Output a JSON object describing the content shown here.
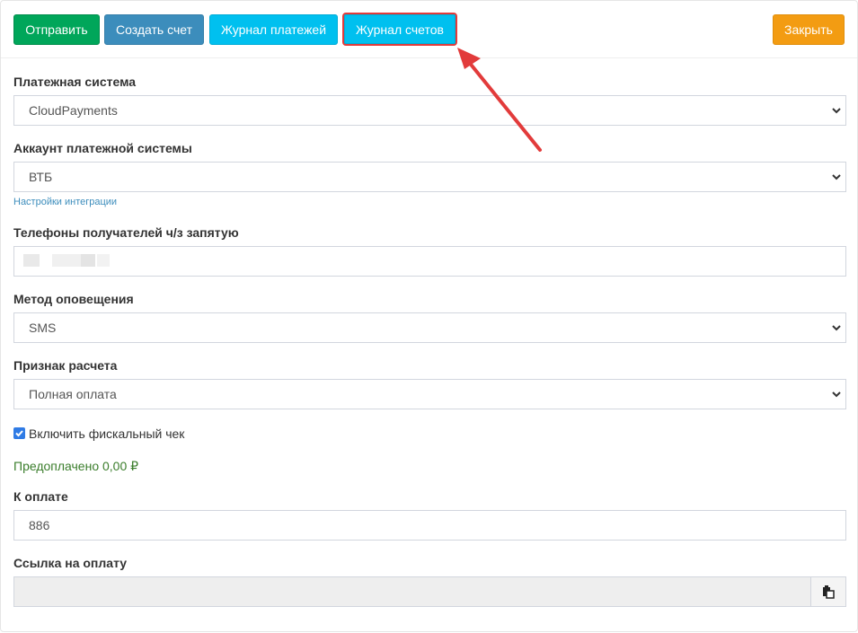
{
  "toolbar": {
    "send_label": "Отправить",
    "create_invoice_label": "Создать счет",
    "payments_log_label": "Журнал платежей",
    "invoices_log_label": "Журнал счетов",
    "close_label": "Закрыть"
  },
  "form": {
    "payment_system": {
      "label": "Платежная система",
      "value": "CloudPayments"
    },
    "account": {
      "label": "Аккаунт платежной системы",
      "value": "ВТБ",
      "link": "Настройки интеграции"
    },
    "phones": {
      "label": "Телефоны получателей ч/з запятую",
      "value": ""
    },
    "notify_method": {
      "label": "Метод оповещения",
      "value": "SMS"
    },
    "payment_sign": {
      "label": "Признак расчета",
      "value": "Полная оплата"
    },
    "fiscal": {
      "label": "Включить фискальный чек",
      "checked": true
    },
    "prepaid": "Предоплачено 0,00 ₽",
    "amount": {
      "label": "К оплате",
      "value": "886"
    },
    "pay_link": {
      "label": "Ссылка на оплату",
      "value": ""
    }
  },
  "colors": {
    "send": "#00a65a",
    "create_invoice": "#3c8dbc",
    "log": "#00c0ef",
    "close": "#f39c12",
    "highlight": "#e23b3b",
    "prepaid_text": "#3a7d2b"
  },
  "icons": [
    "chevron-down-icon",
    "checkmark-icon",
    "copy-icon",
    "annotation-arrow"
  ]
}
